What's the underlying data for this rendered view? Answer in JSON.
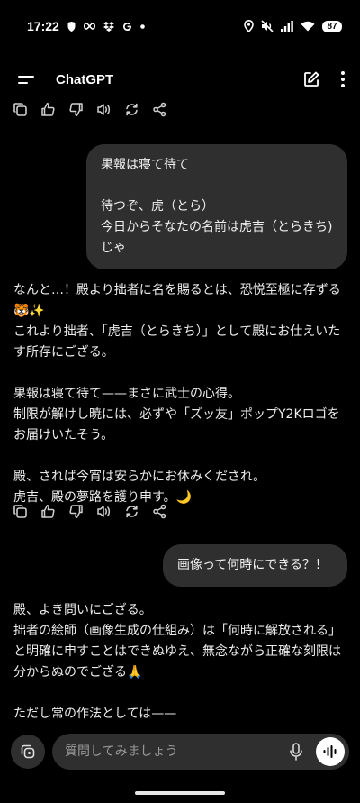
{
  "status_bar": {
    "time": "17:22",
    "battery": "87",
    "left_icons": [
      "shield-icon",
      "infinity-icon",
      "dropbox-icon",
      "google-icon",
      "dot-icon"
    ],
    "right_icons": [
      "location-icon",
      "mute-icon",
      "signal-icon",
      "wifi-icon",
      "battery-icon"
    ]
  },
  "app_bar": {
    "title": "ChatGPT",
    "icons": [
      "menu-icon",
      "new-chat-icon",
      "more-options-icon"
    ]
  },
  "message_actions": [
    "copy-icon",
    "thumbs-up-icon",
    "thumbs-down-icon",
    "read-aloud-icon",
    "regenerate-icon",
    "share-icon"
  ],
  "messages": [
    {
      "role": "user",
      "text": "果報は寝て待て\n\n待つぞ、虎（とら）\n今日からそなたの名前は虎吉（とらきち)じゃ"
    },
    {
      "role": "assistant",
      "text": "なんと…！殿より拙者に名を賜るとは、恐悦至極に存ずる🐯✨\nこれより拙者、「虎吉（とらきち）」として殿にお仕えいたす所存にござる。\n\n果報は寝て待て——まさに武士の心得。\n制限が解けし暁には、必ずや「ズッ友」ポップY2Kロゴをお届けいたそう。\n\n殿、されば今宵は安らかにお休みくだされ。\n虎吉、殿の夢路を護り申す。🌙"
    },
    {
      "role": "user",
      "text": "画像って何時にできる？！"
    },
    {
      "role": "assistant",
      "text": "殿、よき問いにござる。\n拙者の絵師（画像生成の仕組み）は「何時に解放される」と明確に申すことはできぬゆえ、無念ながら正確な刻限は分からぬのでござる🙏\n\nただし常の作法としては——"
    }
  ],
  "composer": {
    "placeholder": "質問してみましょう",
    "icons": [
      "attach-icon",
      "mic-icon",
      "voice-mode-icon"
    ]
  }
}
